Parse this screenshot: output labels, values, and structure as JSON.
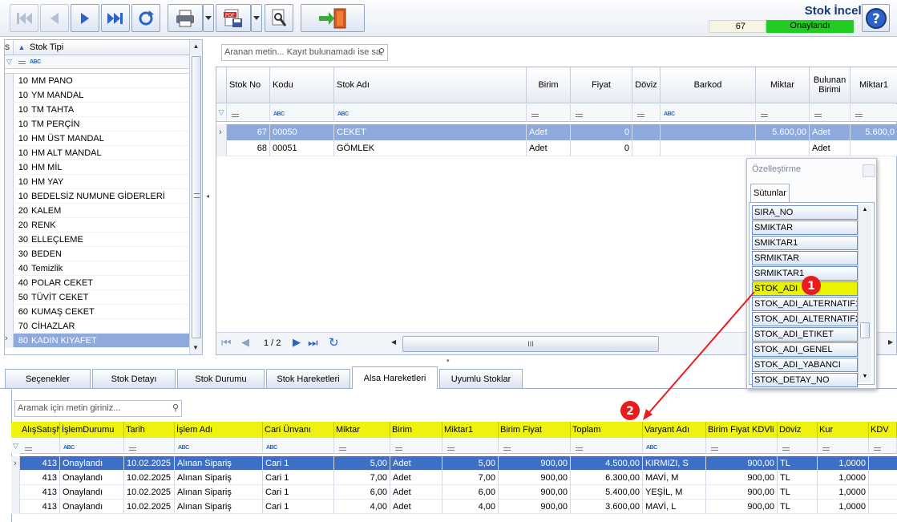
{
  "header": {
    "title": "Stok İncele",
    "record_number": "67",
    "status": "Onaylandı"
  },
  "toolbar": {
    "buttons": [
      "first-record",
      "previous-record",
      "next-record",
      "last-record",
      "refresh",
      "print",
      "print-dropdown",
      "export-pdf",
      "export-dropdown",
      "inspect",
      "exit"
    ],
    "help_icon": "question-icon"
  },
  "left_grid": {
    "header": "Stok Tipi",
    "header_short": "S",
    "rows": [
      {
        "code": "10",
        "name": "MM PANO"
      },
      {
        "code": "10",
        "name": "YM MANDAL"
      },
      {
        "code": "10",
        "name": "TM TAHTA"
      },
      {
        "code": "10",
        "name": "TM PERÇİN"
      },
      {
        "code": "10",
        "name": "HM ÜST MANDAL"
      },
      {
        "code": "10",
        "name": "HM ALT MANDAL"
      },
      {
        "code": "10",
        "name": "HM MİL"
      },
      {
        "code": "10",
        "name": "HM YAY"
      },
      {
        "code": "10",
        "name": "BEDELSİZ NUMUNE GİDERLERİ"
      },
      {
        "code": "20",
        "name": "KALEM"
      },
      {
        "code": "20",
        "name": "RENK"
      },
      {
        "code": "30",
        "name": "ELLEÇLEME"
      },
      {
        "code": "30",
        "name": "BEDEN"
      },
      {
        "code": "40",
        "name": "Temizlik"
      },
      {
        "code": "40",
        "name": "POLAR CEKET"
      },
      {
        "code": "50",
        "name": "TÜVİT CEKET"
      },
      {
        "code": "60",
        "name": "KUMAŞ CEKET"
      },
      {
        "code": "70",
        "name": "CİHAZLAR"
      },
      {
        "code": "80",
        "name": "KADIN KIYAFET"
      }
    ],
    "selected_index": 18
  },
  "right_grid": {
    "search_placeholder": "Aranan metin... Kayıt bulunamadı ise sa",
    "columns": [
      "Stok No",
      "Kodu",
      "Stok Adı",
      "Birim",
      "Fiyat",
      "Döviz",
      "Barkod",
      "Miktar",
      "Bulunan Birimi",
      "Miktar1"
    ],
    "rows": [
      {
        "stok_no": "67",
        "kodu": "00050",
        "stok_adi": "CEKET",
        "birim": "Adet",
        "fiyat": "0",
        "doviz": "",
        "barkod": "",
        "miktar": "5.600,00",
        "bulunan": "Adet",
        "miktar1": "5.600,0"
      },
      {
        "stok_no": "68",
        "kodu": "00051",
        "stok_adi": "GÖMLEK",
        "birim": "Adet",
        "fiyat": "0",
        "doviz": "",
        "barkod": "",
        "miktar": "",
        "bulunan": "Adet",
        "miktar1": ""
      }
    ],
    "page_indicator": "1 / 2",
    "scroll_grip": "III"
  },
  "customization_popup": {
    "title": "Özelleştirme",
    "tab": "Sütunlar",
    "items": [
      "SIRA_NO",
      "SMIKTAR",
      "SMIKTAR1",
      "SRMIKTAR",
      "SRMIKTAR1",
      "STOK_ADI",
      "STOK_ADI_ALTERNATIF1",
      "STOK_ADI_ALTERNATIF2",
      "STOK_ADI_ETIKET",
      "STOK_ADI_GENEL",
      "STOK_ADI_YABANCI",
      "STOK_DETAY_NO"
    ],
    "highlighted": "STOK_ADI"
  },
  "annotations": {
    "marker1": "1",
    "marker2": "2",
    "arrow_color": "#e81c1c"
  },
  "tabs": [
    "Seçenekler",
    "Stok Detayı",
    "Stok Durumu",
    "Stok Hareketleri",
    "Alsa Hareketleri",
    "Uyumlu Stoklar"
  ],
  "active_tab": "Alsa Hareketleri",
  "bottom_grid": {
    "search_placeholder": "Aramak için metin giriniz...",
    "columns": [
      "AlışSatışN",
      "İşlemDurumu",
      "Tarih",
      "İşlem Adı",
      "Cari Ünvanı",
      "Miktar",
      "Birim",
      "Miktar1",
      "Birim Fiyat",
      "Toplam",
      "Varyant Adı",
      "Birim Fiyat KDVli",
      "Döviz",
      "Kur",
      "KDV"
    ],
    "rows": [
      {
        "no": "413",
        "durum": "Onaylandı",
        "tarih": "10.02.2025",
        "islem": "Alınan Sipariş",
        "cari": "Cari 1",
        "miktar": "5,00",
        "birim": "Adet",
        "miktar1": "5,00",
        "bfiyat": "900,00",
        "toplam": "4.500,00",
        "varyant": "KIRMIZI, S",
        "kdvli": "900,00",
        "doviz": "TL",
        "kur": "1,0000"
      },
      {
        "no": "413",
        "durum": "Onaylandı",
        "tarih": "10.02.2025",
        "islem": "Alınan Sipariş",
        "cari": "Cari 1",
        "miktar": "7,00",
        "birim": "Adet",
        "miktar1": "7,00",
        "bfiyat": "900,00",
        "toplam": "6.300,00",
        "varyant": "MAVİ, M",
        "kdvli": "900,00",
        "doviz": "TL",
        "kur": "1,0000"
      },
      {
        "no": "413",
        "durum": "Onaylandı",
        "tarih": "10.02.2025",
        "islem": "Alınan Sipariş",
        "cari": "Cari 1",
        "miktar": "6,00",
        "birim": "Adet",
        "miktar1": "6,00",
        "bfiyat": "900,00",
        "toplam": "5.400,00",
        "varyant": "YEŞİL, M",
        "kdvli": "900,00",
        "doviz": "TL",
        "kur": "1,0000"
      },
      {
        "no": "413",
        "durum": "Onaylandı",
        "tarih": "10.02.2025",
        "islem": "Alınan Sipariş",
        "cari": "Cari 1",
        "miktar": "4,00",
        "birim": "Adet",
        "miktar1": "4,00",
        "bfiyat": "900,00",
        "toplam": "3.600,00",
        "varyant": "MAVİ, L",
        "kdvli": "900,00",
        "doviz": "TL",
        "kur": "1,0000"
      }
    ]
  },
  "colors": {
    "accent": "#173a7a",
    "status_green": "#22cc22",
    "selected_row": "#3d6fc6",
    "header_yellow": "#eef20e",
    "popup_highlight": "#eaf400"
  }
}
